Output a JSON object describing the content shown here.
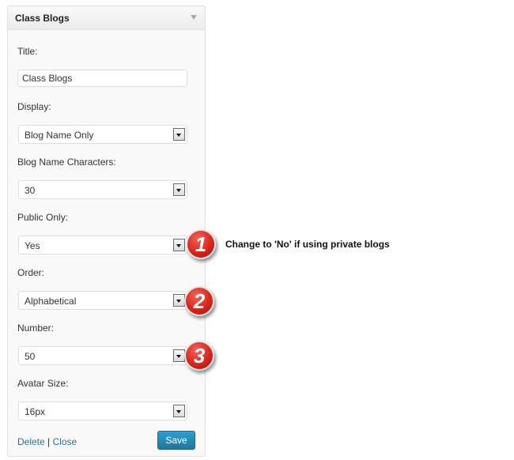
{
  "widget": {
    "title": "Class Blogs",
    "fields": {
      "title": {
        "label": "Title:",
        "value": "Class Blogs"
      },
      "display": {
        "label": "Display:",
        "value": "Blog Name Only"
      },
      "blog_name_characters": {
        "label": "Blog Name Characters:",
        "value": "30"
      },
      "public_only": {
        "label": "Public Only:",
        "value": "Yes"
      },
      "order": {
        "label": "Order:",
        "value": "Alphabetical"
      },
      "number": {
        "label": "Number:",
        "value": "50"
      },
      "avatar_size": {
        "label": "Avatar Size:",
        "value": "16px"
      }
    },
    "footer": {
      "delete_label": "Delete",
      "separator": " | ",
      "close_label": "Close",
      "save_label": "Save"
    }
  },
  "annotations": {
    "badges": [
      "1",
      "2",
      "3"
    ],
    "note": "Change to 'No' if using private blogs"
  },
  "colors": {
    "link": "#21759b",
    "save_button": "#21759b",
    "badge": "#d8261c"
  }
}
